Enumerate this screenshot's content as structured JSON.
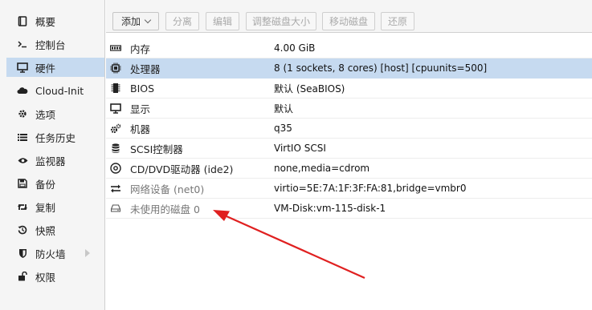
{
  "sidebar": {
    "items": [
      {
        "label": "概要",
        "icon": "book-icon"
      },
      {
        "label": "控制台",
        "icon": "terminal-icon"
      },
      {
        "label": "硬件",
        "icon": "monitor-icon"
      },
      {
        "label": "Cloud-Init",
        "icon": "cloud-icon"
      },
      {
        "label": "选项",
        "icon": "gear-icon"
      },
      {
        "label": "任务历史",
        "icon": "list-icon"
      },
      {
        "label": "监视器",
        "icon": "eye-icon"
      },
      {
        "label": "备份",
        "icon": "floppy-icon"
      },
      {
        "label": "复制",
        "icon": "retweet-icon"
      },
      {
        "label": "快照",
        "icon": "history-icon"
      },
      {
        "label": "防火墙",
        "icon": "shield-icon"
      },
      {
        "label": "权限",
        "icon": "unlock-icon"
      }
    ],
    "selected_index": 2
  },
  "toolbar": {
    "add": "添加",
    "detach": "分离",
    "edit": "编辑",
    "resize": "调整磁盘大小",
    "move": "移动磁盘",
    "revert": "还原"
  },
  "hardware": {
    "rows": [
      {
        "icon": "memory-icon",
        "label": "内存",
        "value": "4.00 GiB"
      },
      {
        "icon": "cpu-icon",
        "label": "处理器",
        "value": "8 (1 sockets, 8 cores) [host] [cpuunits=500]"
      },
      {
        "icon": "chip-icon",
        "label": "BIOS",
        "value": "默认 (SeaBIOS)"
      },
      {
        "icon": "display-icon",
        "label": "显示",
        "value": "默认"
      },
      {
        "icon": "cogs-icon",
        "label": "机器",
        "value": "q35"
      },
      {
        "icon": "database-icon",
        "label": "SCSI控制器",
        "value": "VirtIO SCSI"
      },
      {
        "icon": "cdrom-icon",
        "label": "CD/DVD驱动器 (ide2)",
        "value": "none,media=cdrom"
      },
      {
        "icon": "exchange-icon",
        "label": "网络设备 (net0)",
        "value": "virtio=5E:7A:1F:3F:FA:81,bridge=vmbr0"
      },
      {
        "icon": "hdd-icon",
        "label": "未使用的磁盘 0",
        "value": "VM-Disk:vm-115-disk-1"
      }
    ],
    "selected_index": 1
  },
  "colors": {
    "annotation_arrow": "#e02020",
    "selection": "#c6daf0"
  }
}
